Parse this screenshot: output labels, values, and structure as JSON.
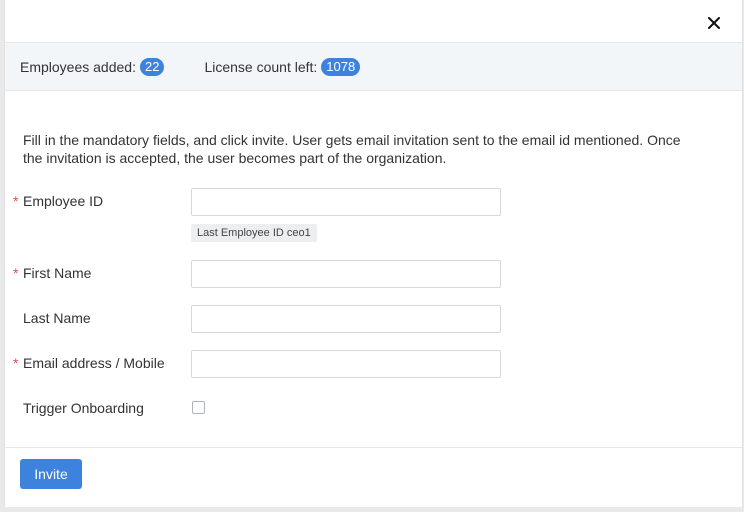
{
  "stats": {
    "employees_added_label": "Employees added:",
    "employees_added_count": "22",
    "license_left_label": "License count left:",
    "license_left_count": "1078"
  },
  "description": "Fill in the mandatory fields, and click invite. User gets email invitation sent to the email id mentioned. Once the invitation is accepted, the user becomes part of the organization.",
  "form": {
    "employee_id": {
      "label": "Employee ID",
      "required": true,
      "value": "",
      "hint": "Last Employee ID ceo1"
    },
    "first_name": {
      "label": "First Name",
      "required": true,
      "value": ""
    },
    "last_name": {
      "label": "Last Name",
      "required": false,
      "value": ""
    },
    "email": {
      "label": "Email address / Mobile",
      "required": true,
      "value": ""
    },
    "trigger_onboarding": {
      "label": "Trigger Onboarding",
      "checked": false
    }
  },
  "footer": {
    "invite_label": "Invite"
  },
  "icons": {
    "close": "close-icon"
  },
  "colors": {
    "accent": "#3d82dd",
    "required": "#e24b4b"
  }
}
